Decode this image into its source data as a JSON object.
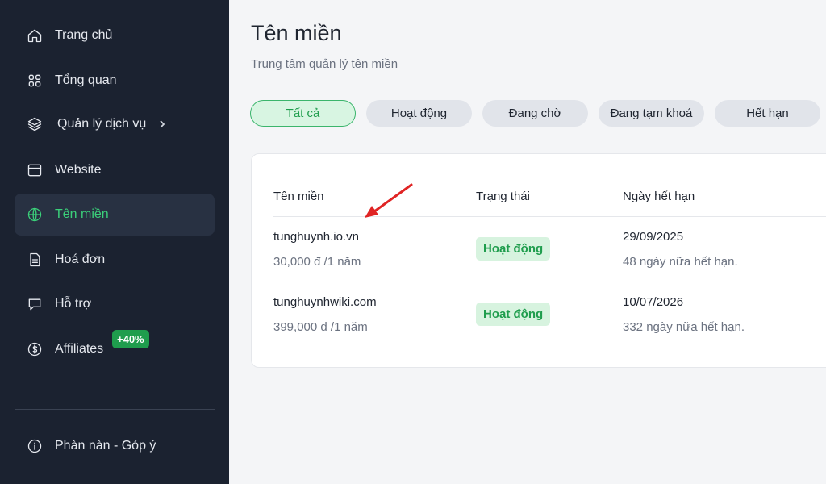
{
  "sidebar": {
    "items": [
      {
        "label": "Trang chủ",
        "icon": "home-icon"
      },
      {
        "label": "Tổng quan",
        "icon": "grid-icon"
      },
      {
        "label": "Quản lý dịch vụ",
        "icon": "layers-icon"
      },
      {
        "label": "Website",
        "icon": "browser-icon"
      },
      {
        "label": "Tên miền",
        "icon": "globe-icon"
      },
      {
        "label": "Hoá đơn",
        "icon": "invoice-icon"
      },
      {
        "label": "Hỗ trợ",
        "icon": "chat-icon"
      },
      {
        "label": "Affiliates",
        "icon": "dollar-icon",
        "badge": "+40%"
      }
    ],
    "footer_item": {
      "label": "Phàn nàn - Góp ý",
      "icon": "info-icon"
    },
    "active_color": "#3bd07a"
  },
  "page": {
    "title": "Tên miền",
    "subtitle": "Trung tâm quản lý tên miền"
  },
  "filters": [
    "Tất cả",
    "Hoạt động",
    "Đang chờ",
    "Đang tạm khoá",
    "Hết hạn"
  ],
  "table": {
    "headers": [
      "Tên miền",
      "Trạng thái",
      "Ngày hết hạn"
    ],
    "rows": [
      {
        "name": "tunghuynh.io.vn",
        "price": "30,000 đ /1 năm",
        "status": "Hoạt động",
        "date": "29/09/2025",
        "remain": "48 ngày nữa hết hạn."
      },
      {
        "name": "tunghuynhwiki.com",
        "price": "399,000 đ /1 năm",
        "status": "Hoạt động",
        "date": "10/07/2026",
        "remain": "332 ngày nữa hết hạn."
      }
    ]
  },
  "colors": {
    "sidebar_bg": "#1b2230",
    "accent_green": "#1f9d4d",
    "annotation_arrow": "#e02424"
  }
}
